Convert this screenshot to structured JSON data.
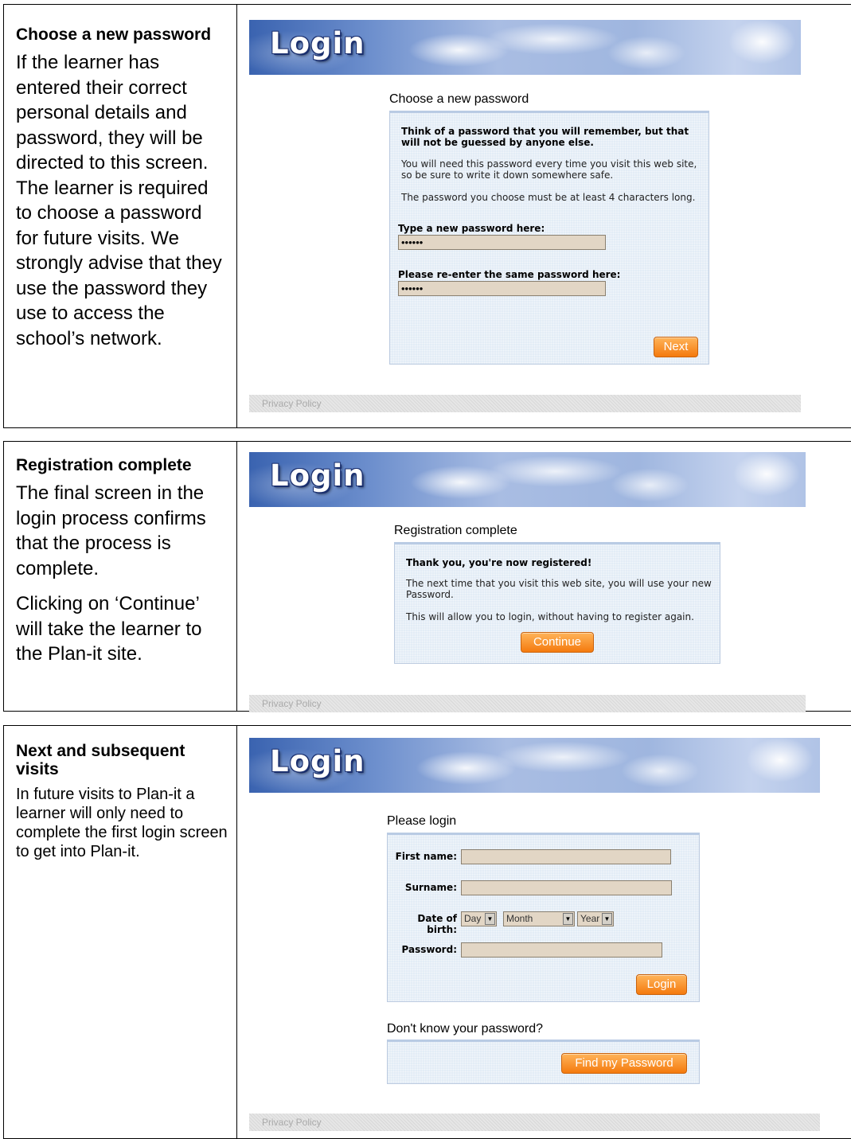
{
  "sections": [
    {
      "heading": "Choose a new password",
      "paragraphs": [
        "If the learner has entered their correct personal details and password, they will be directed to this screen. The learner is required to choose a password for future visits. We strongly advise that they use the password they use to access the school’s network."
      ],
      "screen": {
        "banner": "Login",
        "page_title": "Choose a new password",
        "box_heading": "Think of a password that you will remember, but that will not be guessed by anyone else.",
        "box_text_1": "You will need this password every time you visit this web site, so be sure to write it down somewhere safe.",
        "box_text_2": "The password you choose must be at least 4 characters long.",
        "new_password_label": "Type a new password here:",
        "new_password_value": "••••••",
        "reenter_label": "Please re-enter the same password here:",
        "reenter_value": "••••••",
        "next_button": "Next",
        "privacy": "Privacy Policy"
      }
    },
    {
      "heading": "Registration complete",
      "paragraphs": [
        "The final screen in the login process confirms that the process is complete.",
        "Clicking on ‘Continue’ will take the learner to the Plan-it site."
      ],
      "screen": {
        "banner": "Login",
        "page_title": "Registration complete",
        "box_heading": "Thank you, you're now registered!",
        "box_text_1": "The next time that you visit this web site, you will use your new Password.",
        "box_text_2": "This will allow you to login, without having to register again.",
        "continue_button": "Continue",
        "privacy": "Privacy Policy"
      }
    },
    {
      "heading": "Next and subsequent visits",
      "paragraphs": [
        "In future visits to Plan-it a learner will only need to complete the first login screen to get into Plan-it."
      ],
      "screen": {
        "banner": "Login",
        "page_title": "Please login",
        "first_name_label": "First name:",
        "surname_label": "Surname:",
        "dob_label": "Date of birth:",
        "day_select": "Day",
        "month_select": "Month",
        "year_select": "Year",
        "password_label": "Password:",
        "login_button": "Login",
        "forgot_title": "Don't know your password?",
        "find_button": "Find my Password",
        "privacy": "Privacy Policy"
      }
    }
  ]
}
